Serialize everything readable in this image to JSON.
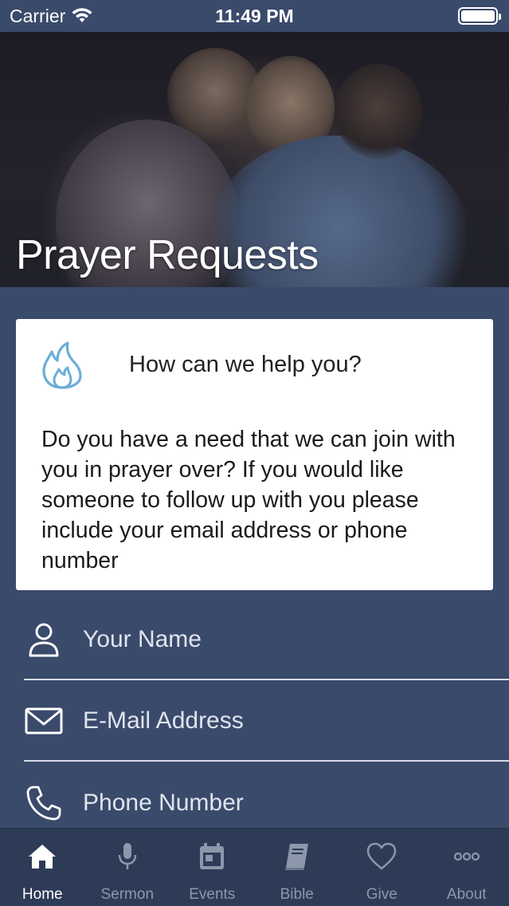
{
  "status_bar": {
    "carrier": "Carrier",
    "time": "11:49 PM"
  },
  "hero": {
    "title": "Prayer Requests"
  },
  "card": {
    "heading": "How can we help you?",
    "body": "Do you have a need that we can join with you in prayer over? If you would like someone to follow up with you please include your email address or phone number",
    "icon": "fire-icon",
    "icon_color": "#6aaed6"
  },
  "form": {
    "name_placeholder": "Your Name",
    "email_placeholder": "E-Mail Address",
    "phone_placeholder": "Phone Number"
  },
  "tabs": [
    {
      "label": "Home",
      "icon": "home-icon",
      "active": true
    },
    {
      "label": "Sermon",
      "icon": "microphone-icon",
      "active": false
    },
    {
      "label": "Events",
      "icon": "calendar-icon",
      "active": false
    },
    {
      "label": "Bible",
      "icon": "book-icon",
      "active": false
    },
    {
      "label": "Give",
      "icon": "heart-icon",
      "active": false
    },
    {
      "label": "About",
      "icon": "more-icon",
      "active": false
    }
  ],
  "colors": {
    "background": "#3a4a6b",
    "tab_bar": "#2e3b57",
    "tab_active": "#ffffff",
    "tab_inactive": "#8d97ab"
  }
}
